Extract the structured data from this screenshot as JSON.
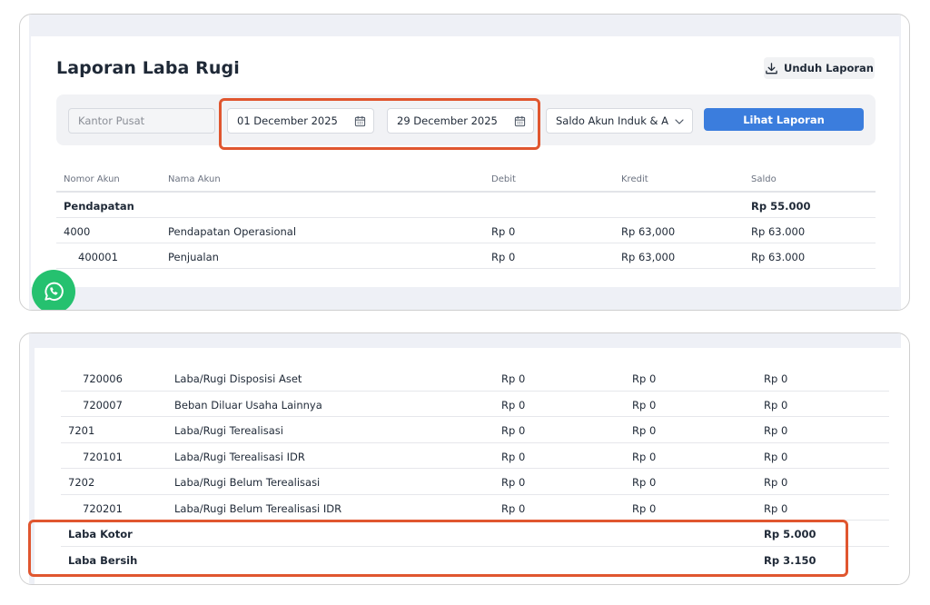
{
  "report": {
    "title": "Laporan Laba Rugi",
    "download_label": "Unduh Laporan"
  },
  "filters": {
    "branch": "Kantor Pusat",
    "start_date": "01 December 2025",
    "end_date": "29 December 2025",
    "balance_mode": "Saldo Akun Induk & Anc",
    "submit_label": "Lihat Laporan"
  },
  "table": {
    "columns": [
      "Nomor Akun",
      "Nama Akun",
      "Debit",
      "Kredit",
      "Saldo"
    ],
    "section_label": "Pendapatan",
    "section_total": "Rp 55.000",
    "rows_top": [
      {
        "code": "4000",
        "name": "Pendapatan Operasional",
        "debit": "Rp 0",
        "credit": "Rp 63,000",
        "balance": "Rp 63.000"
      },
      {
        "code": "400001",
        "name": "Penjualan",
        "debit": "Rp 0",
        "credit": "Rp 63,000",
        "balance": "Rp 63.000"
      }
    ],
    "rows_bottom": [
      {
        "code": "720006",
        "name": "Laba/Rugi Disposisi Aset",
        "debit": "Rp 0",
        "credit": "Rp 0",
        "balance": "Rp 0"
      },
      {
        "code": "720007",
        "name": "Beban Diluar Usaha Lainnya",
        "debit": "Rp 0",
        "credit": "Rp 0",
        "balance": "Rp 0"
      },
      {
        "code": "7201",
        "name": "Laba/Rugi Terealisasi",
        "debit": "Rp 0",
        "credit": "Rp 0",
        "balance": "Rp 0"
      },
      {
        "code": "720101",
        "name": "Laba/Rugi Terealisasi IDR",
        "debit": "Rp 0",
        "credit": "Rp 0",
        "balance": "Rp 0"
      },
      {
        "code": "7202",
        "name": "Laba/Rugi Belum Terealisasi",
        "debit": "Rp 0",
        "credit": "Rp 0",
        "balance": "Rp 0"
      },
      {
        "code": "720201",
        "name": "Laba/Rugi Belum Terealisasi IDR",
        "debit": "Rp 0",
        "credit": "Rp 0",
        "balance": "Rp 0"
      }
    ],
    "totals": [
      {
        "label": "Laba Kotor",
        "value": "Rp 5.000"
      },
      {
        "label": "Laba Bersih",
        "value": "Rp 3.150"
      }
    ]
  },
  "icons": {
    "download": "download-icon",
    "calendar": "calendar-icon",
    "chevron": "chevron-down-icon",
    "chat": "whatsapp-icon"
  },
  "colors": {
    "primary": "#3b7ddd",
    "highlight": "#e0562f",
    "whatsapp": "#25c16f"
  }
}
